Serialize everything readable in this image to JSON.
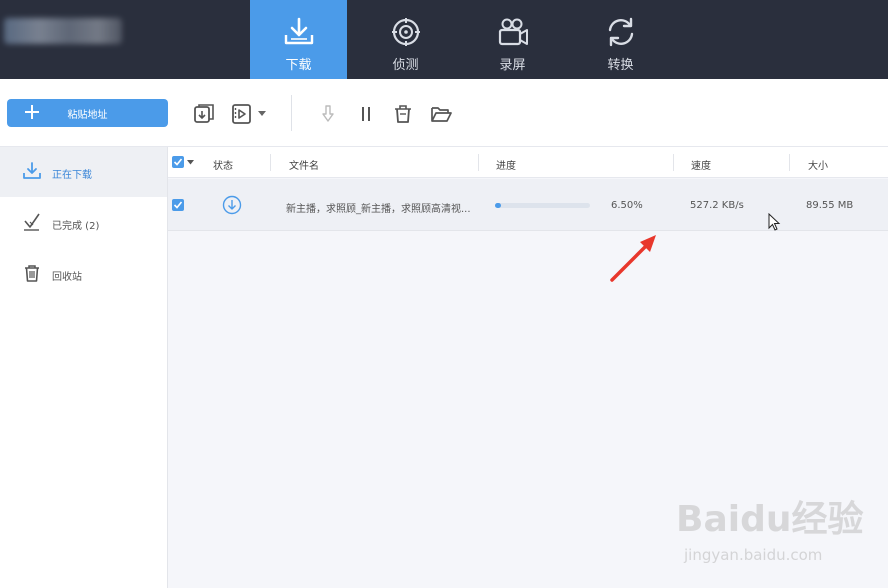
{
  "nav": {
    "tabs": [
      {
        "label": "下载",
        "icon": "download-tray-icon",
        "active": true
      },
      {
        "label": "侦测",
        "icon": "target-icon",
        "active": false
      },
      {
        "label": "录屏",
        "icon": "camera-icon",
        "active": false
      },
      {
        "label": "转换",
        "icon": "convert-icon",
        "active": false
      }
    ]
  },
  "toolbar": {
    "paste_label": "粘贴地址",
    "icons": [
      "import-task-icon",
      "video-icon",
      "dropdown-arrow-icon",
      "start-icon",
      "pause-icon",
      "delete-icon",
      "open-folder-icon"
    ]
  },
  "sidebar": {
    "items": [
      {
        "label": "正在下载",
        "icon": "download-icon",
        "active": true
      },
      {
        "label": "已完成 (2)",
        "icon": "completed-check-icon",
        "active": false
      },
      {
        "label": "回收站",
        "icon": "trash-icon",
        "active": false
      }
    ]
  },
  "table": {
    "headers": {
      "status": "状态",
      "filename": "文件名",
      "progress": "进度",
      "speed": "速度",
      "size": "大小"
    },
    "rows": [
      {
        "filename": "新主播，求照顾_新主播，求照顾高清视...",
        "progress_text": "6.50%",
        "progress_value": 6.5,
        "speed": "527.2 KB/s",
        "size": "89.55 MB"
      }
    ]
  },
  "watermark": {
    "brand": "Baidu经验",
    "url": "jingyan.baidu.com"
  },
  "colors": {
    "accent": "#4b9be9",
    "topbar": "#2a2f3d",
    "annotation": "#e8372c"
  }
}
